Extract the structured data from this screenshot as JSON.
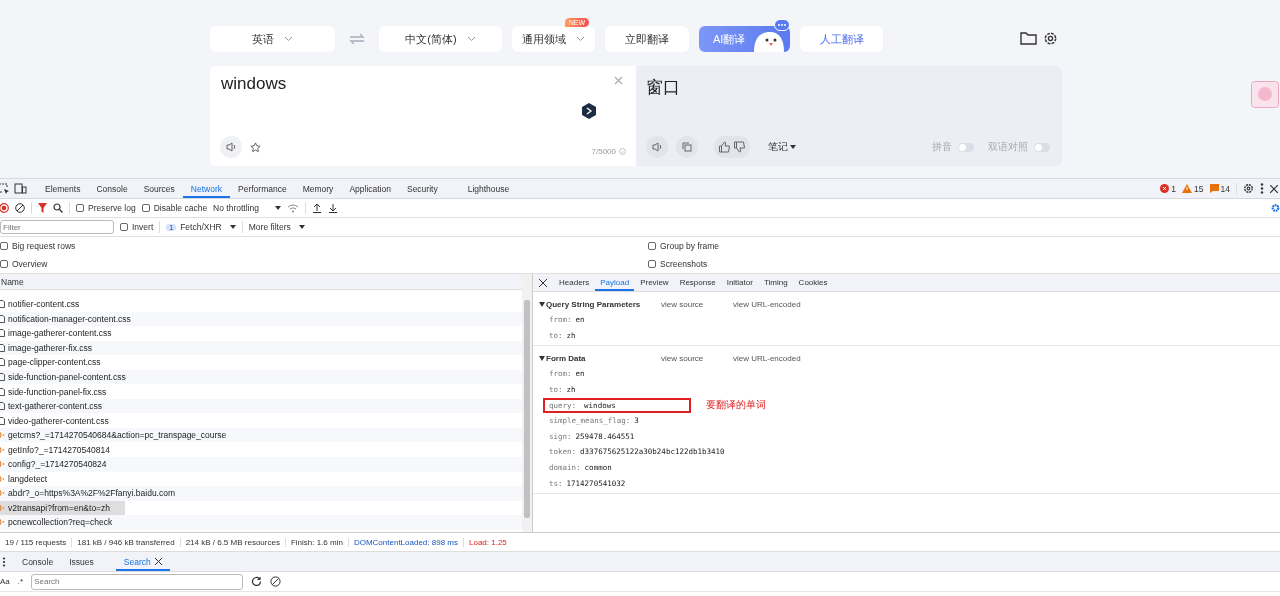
{
  "translator": {
    "source_lang": "英语",
    "target_lang": "中文(简体)",
    "domain": {
      "label": "通用领域",
      "badge": "NEW"
    },
    "buttons": [
      {
        "label": "立即翻译",
        "kind": "plain"
      },
      {
        "label": "AI翻译",
        "kind": "ai"
      },
      {
        "label": "人工翻译",
        "kind": "link"
      }
    ],
    "input": {
      "value": "windows",
      "count": "7/5000"
    },
    "output": {
      "text": "窗口",
      "notes": "笔记",
      "toggles": [
        {
          "label": "拼音",
          "on": false
        },
        {
          "label": "双语对照",
          "on": false
        }
      ]
    }
  },
  "devtools": {
    "tabs": [
      {
        "label": "Elements",
        "selected": false
      },
      {
        "label": "Console",
        "selected": false
      },
      {
        "label": "Sources",
        "selected": false
      },
      {
        "label": "Network",
        "selected": true
      },
      {
        "label": "Performance",
        "selected": false
      },
      {
        "label": "Memory",
        "selected": false
      },
      {
        "label": "Application",
        "selected": false
      },
      {
        "label": "Security",
        "selected": false
      },
      {
        "label": "Lighthouse",
        "selected": false
      }
    ],
    "issues": {
      "errors": "1",
      "warnings": "15",
      "info": "14"
    },
    "toolbar": {
      "checks": [
        {
          "label": "Preserve log",
          "checked": false
        },
        {
          "label": "Disable cache",
          "checked": false
        }
      ],
      "throttling": "No throttling"
    },
    "filter": {
      "placeholder": "Filter",
      "invert": {
        "label": "Invert",
        "checked": false
      },
      "type_count": "1",
      "type_label": "Fetch/XHR",
      "more_filters": "More filters"
    },
    "options": [
      {
        "label": "Big request rows",
        "checked": false
      },
      {
        "label": "Group by frame",
        "checked": false
      },
      {
        "label": "Overview",
        "checked": false
      },
      {
        "label": "Screenshots",
        "checked": false
      }
    ],
    "requests": {
      "column": "Name",
      "rows": [
        {
          "name": "notifier-content.css",
          "kind": "doc",
          "selected": false
        },
        {
          "name": "notification-manager-content.css",
          "kind": "doc",
          "selected": false
        },
        {
          "name": "image-gatherer-content.css",
          "kind": "doc",
          "selected": false
        },
        {
          "name": "image-gatherer-fix.css",
          "kind": "doc",
          "selected": false
        },
        {
          "name": "page-clipper-content.css",
          "kind": "doc",
          "selected": false
        },
        {
          "name": "side-function-panel-content.css",
          "kind": "doc",
          "selected": false
        },
        {
          "name": "side-function-panel-fix.css",
          "kind": "doc",
          "selected": false
        },
        {
          "name": "text-gatherer-content.css",
          "kind": "doc",
          "selected": false
        },
        {
          "name": "video-gatherer-content.css",
          "kind": "doc",
          "selected": false
        },
        {
          "name": "getcms?_=1714270540684&action=pc_transpage_course",
          "kind": "xhr",
          "selected": false
        },
        {
          "name": "getInfo?_=1714270540814",
          "kind": "xhr",
          "selected": false
        },
        {
          "name": "config?_=1714270540824",
          "kind": "xhr",
          "selected": false
        },
        {
          "name": "langdetect",
          "kind": "xhr",
          "selected": false
        },
        {
          "name": "abdr?_o=https%3A%2F%2Ffanyi.baidu.com",
          "kind": "xhr",
          "selected": false
        },
        {
          "name": "v2transapi?from=en&to=zh",
          "kind": "xhr",
          "selected": true
        },
        {
          "name": "pcnewcollection?req=check",
          "kind": "xhr",
          "selected": false
        }
      ]
    },
    "detail_tabs": [
      {
        "label": "Headers",
        "selected": false
      },
      {
        "label": "Payload",
        "selected": true
      },
      {
        "label": "Preview",
        "selected": false
      },
      {
        "label": "Response",
        "selected": false
      },
      {
        "label": "Initiator",
        "selected": false
      },
      {
        "label": "Timing",
        "selected": false
      },
      {
        "label": "Cookies",
        "selected": false
      }
    ],
    "sections": [
      {
        "title": "Query String Parameters",
        "view_source": "view source",
        "view_encoded": "view URL-encoded",
        "params": [
          {
            "key": "from:",
            "value": "en",
            "highlighted": false
          },
          {
            "key": "to:",
            "value": "zh",
            "highlighted": false
          }
        ]
      },
      {
        "title": "Form Data",
        "view_source": "view source",
        "view_encoded": "view URL-encoded",
        "params": [
          {
            "key": "from:",
            "value": "en",
            "highlighted": false
          },
          {
            "key": "to:",
            "value": "zh",
            "highlighted": false
          },
          {
            "key": "query:",
            "value": "windows",
            "highlighted": true
          },
          {
            "key": "simple_means_flag:",
            "value": "3",
            "highlighted": false
          },
          {
            "key": "sign:",
            "value": "259478.464551",
            "highlighted": false
          },
          {
            "key": "token:",
            "value": "d337675625122a30b24bc122db1b3410",
            "highlighted": false
          },
          {
            "key": "domain:",
            "value": "common",
            "highlighted": false
          },
          {
            "key": "ts:",
            "value": "1714270541032",
            "highlighted": false
          }
        ]
      }
    ],
    "annotation": "要翻译的单词",
    "status": [
      {
        "text": "19 / 115 requests",
        "kind": "plain"
      },
      {
        "text": "181 kB / 946 kB transferred",
        "kind": "plain"
      },
      {
        "text": "214 kB / 6.5 MB resources",
        "kind": "plain"
      },
      {
        "text": "Finish: 1.6 min",
        "kind": "plain"
      },
      {
        "text": "DOMContentLoaded: 898 ms",
        "kind": "blue"
      },
      {
        "text": "Load: 1.25",
        "kind": "red"
      }
    ],
    "drawer": {
      "tabs": [
        {
          "label": "Console",
          "selected": false,
          "closable": false
        },
        {
          "label": "Issues",
          "selected": false,
          "closable": false
        },
        {
          "label": "Search",
          "selected": true,
          "closable": true
        }
      ],
      "case_label": "Aa",
      "regex_label": ".*",
      "search_placeholder": "Search"
    }
  }
}
